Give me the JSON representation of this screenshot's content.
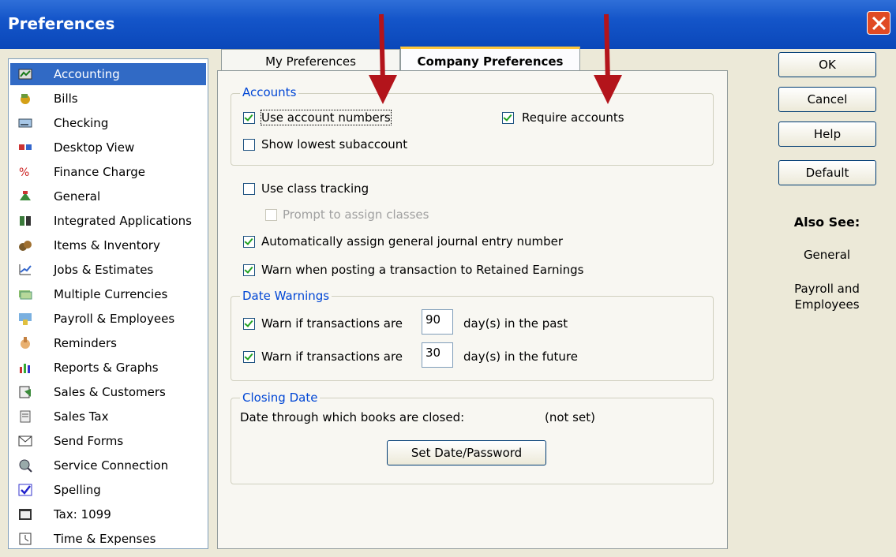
{
  "window": {
    "title": "Preferences"
  },
  "sidebar": {
    "items": [
      {
        "label": "Accounting",
        "icon": "accounting-icon",
        "selected": true
      },
      {
        "label": "Bills",
        "icon": "bills-icon"
      },
      {
        "label": "Checking",
        "icon": "checking-icon"
      },
      {
        "label": "Desktop View",
        "icon": "desktop-view-icon"
      },
      {
        "label": "Finance Charge",
        "icon": "finance-charge-icon"
      },
      {
        "label": "General",
        "icon": "general-icon"
      },
      {
        "label": "Integrated Applications",
        "icon": "integrated-applications-icon"
      },
      {
        "label": "Items & Inventory",
        "icon": "items-inventory-icon"
      },
      {
        "label": "Jobs & Estimates",
        "icon": "jobs-estimates-icon"
      },
      {
        "label": "Multiple Currencies",
        "icon": "multiple-currencies-icon"
      },
      {
        "label": "Payroll & Employees",
        "icon": "payroll-employees-icon"
      },
      {
        "label": "Reminders",
        "icon": "reminders-icon"
      },
      {
        "label": "Reports & Graphs",
        "icon": "reports-graphs-icon"
      },
      {
        "label": "Sales & Customers",
        "icon": "sales-customers-icon"
      },
      {
        "label": "Sales Tax",
        "icon": "sales-tax-icon"
      },
      {
        "label": "Send Forms",
        "icon": "send-forms-icon"
      },
      {
        "label": "Service Connection",
        "icon": "service-connection-icon"
      },
      {
        "label": "Spelling",
        "icon": "spelling-icon"
      },
      {
        "label": "Tax: 1099",
        "icon": "tax-1099-icon"
      },
      {
        "label": "Time & Expenses",
        "icon": "time-expenses-icon"
      }
    ]
  },
  "tabs": {
    "my_preferences": "My Preferences",
    "company_preferences": "Company Preferences",
    "active": "company_preferences"
  },
  "accounts_group": {
    "title": "Accounts",
    "use_account_numbers": {
      "label": "Use account numbers",
      "checked": true
    },
    "require_accounts": {
      "label": "Require accounts",
      "checked": true
    },
    "show_lowest_subaccount": {
      "label": "Show lowest subaccount",
      "checked": false
    }
  },
  "class_tracking": {
    "use_class_tracking": {
      "label": "Use class tracking",
      "checked": false
    },
    "prompt_to_assign_classes": {
      "label": "Prompt to assign classes",
      "checked": false,
      "disabled": true
    }
  },
  "auto_assign_journal": {
    "label": "Automatically assign general journal entry number",
    "checked": true
  },
  "warn_retained_earnings": {
    "label": "Warn when posting a transaction to Retained Earnings",
    "checked": true
  },
  "date_warnings": {
    "title": "Date Warnings",
    "past": {
      "prefix": "Warn if transactions are",
      "days": "90",
      "suffix": "day(s) in the past",
      "checked": true
    },
    "future": {
      "prefix": "Warn if transactions are",
      "days": "30",
      "suffix": "day(s) in the future",
      "checked": true
    }
  },
  "closing_date": {
    "title": "Closing Date",
    "label": "Date through which books are closed:",
    "value": "(not set)",
    "button": "Set Date/Password"
  },
  "buttons": {
    "ok": "OK",
    "cancel": "Cancel",
    "help": "Help",
    "default": "Default"
  },
  "also_see": {
    "title": "Also See:",
    "links": [
      "General",
      "Payroll and Employees"
    ]
  },
  "colors": {
    "selection": "#316ac5",
    "group_title": "#0046d5",
    "arrow": "#b3141b"
  }
}
